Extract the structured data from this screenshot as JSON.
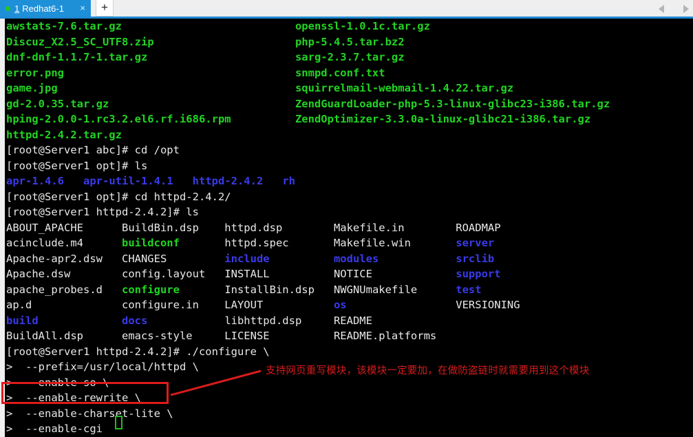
{
  "window": {
    "tab": {
      "index_label": "1",
      "title": "Redhat6-1",
      "status_dot": "connected-green-dot",
      "close_label": "×"
    },
    "new_tab_label": "+",
    "nav_prev_icon": "chevron-left-icon",
    "nav_next_icon": "chevron-right-icon"
  },
  "terminal": {
    "lines": [
      {
        "segments": [
          {
            "text": "awstats-7.6.tar.gz",
            "color": "green"
          },
          {
            "text": "                           ",
            "color": "white"
          },
          {
            "text": "openssl-1.0.1c.tar.gz",
            "color": "green"
          }
        ]
      },
      {
        "segments": [
          {
            "text": "Discuz_X2.5_SC_UTF8.zip",
            "color": "green"
          },
          {
            "text": "                      ",
            "color": "white"
          },
          {
            "text": "php-5.4.5.tar.bz2",
            "color": "green"
          }
        ]
      },
      {
        "segments": [
          {
            "text": "dnf-dnf-1.1.7-1.tar.gz",
            "color": "green"
          },
          {
            "text": "                       ",
            "color": "white"
          },
          {
            "text": "sarg-2.3.7.tar.gz",
            "color": "green"
          }
        ]
      },
      {
        "segments": [
          {
            "text": "error.png",
            "color": "green"
          },
          {
            "text": "                                    ",
            "color": "white"
          },
          {
            "text": "snmpd.conf.txt",
            "color": "green"
          }
        ]
      },
      {
        "segments": [
          {
            "text": "game.jpg",
            "color": "green"
          },
          {
            "text": "                                     ",
            "color": "white"
          },
          {
            "text": "squirrelmail-webmail-1.4.22.tar.gz",
            "color": "green"
          }
        ]
      },
      {
        "segments": [
          {
            "text": "gd-2.0.35.tar.gz",
            "color": "green"
          },
          {
            "text": "                             ",
            "color": "white"
          },
          {
            "text": "ZendGuardLoader-php-5.3-linux-glibc23-i386.tar.gz",
            "color": "green"
          }
        ]
      },
      {
        "segments": [
          {
            "text": "hping-2.0.0-1.rc3.2.el6.rf.i686.rpm",
            "color": "green"
          },
          {
            "text": "          ",
            "color": "white"
          },
          {
            "text": "ZendOptimizer-3.3.0a-linux-glibc21-i386.tar.gz",
            "color": "green"
          }
        ]
      },
      {
        "segments": [
          {
            "text": "httpd-2.4.2.tar.gz",
            "color": "green"
          }
        ]
      },
      {
        "segments": [
          {
            "text": "[root@Server1 abc]# cd /opt",
            "color": "white"
          }
        ]
      },
      {
        "segments": [
          {
            "text": "[root@Server1 opt]# ls",
            "color": "white"
          }
        ]
      },
      {
        "segments": [
          {
            "text": "apr-1.4.6",
            "color": "blue"
          },
          {
            "text": "   ",
            "color": "white"
          },
          {
            "text": "apr-util-1.4.1",
            "color": "blue"
          },
          {
            "text": "   ",
            "color": "white"
          },
          {
            "text": "httpd-2.4.2",
            "color": "blue"
          },
          {
            "text": "   ",
            "color": "white"
          },
          {
            "text": "rh",
            "color": "blue"
          }
        ]
      },
      {
        "segments": [
          {
            "text": "[root@Server1 opt]# cd httpd-2.4.2/",
            "color": "white"
          }
        ]
      },
      {
        "segments": [
          {
            "text": "[root@Server1 httpd-2.4.2]# ls",
            "color": "white"
          }
        ]
      },
      {
        "segments": [
          {
            "text": "ABOUT_APACHE      ",
            "color": "white"
          },
          {
            "text": "BuildBin.dsp    ",
            "color": "white"
          },
          {
            "text": "httpd.dsp        ",
            "color": "white"
          },
          {
            "text": "Makefile.in        ",
            "color": "white"
          },
          {
            "text": "ROADMAP",
            "color": "white"
          }
        ]
      },
      {
        "segments": [
          {
            "text": "acinclude.m4      ",
            "color": "white"
          },
          {
            "text": "buildconf",
            "color": "green"
          },
          {
            "text": "       ",
            "color": "white"
          },
          {
            "text": "httpd.spec       ",
            "color": "white"
          },
          {
            "text": "Makefile.win       ",
            "color": "white"
          },
          {
            "text": "server",
            "color": "blue"
          }
        ]
      },
      {
        "segments": [
          {
            "text": "Apache-apr2.dsw   ",
            "color": "white"
          },
          {
            "text": "CHANGES         ",
            "color": "white"
          },
          {
            "text": "include",
            "color": "blue"
          },
          {
            "text": "          ",
            "color": "white"
          },
          {
            "text": "modules",
            "color": "blue"
          },
          {
            "text": "            ",
            "color": "white"
          },
          {
            "text": "srclib",
            "color": "blue"
          }
        ]
      },
      {
        "segments": [
          {
            "text": "Apache.dsw        ",
            "color": "white"
          },
          {
            "text": "config.layout   ",
            "color": "white"
          },
          {
            "text": "INSTALL          ",
            "color": "white"
          },
          {
            "text": "NOTICE             ",
            "color": "white"
          },
          {
            "text": "support",
            "color": "blue"
          }
        ]
      },
      {
        "segments": [
          {
            "text": "apache_probes.d   ",
            "color": "white"
          },
          {
            "text": "configure",
            "color": "green"
          },
          {
            "text": "       ",
            "color": "white"
          },
          {
            "text": "InstallBin.dsp   ",
            "color": "white"
          },
          {
            "text": "NWGNUmakefile      ",
            "color": "white"
          },
          {
            "text": "test",
            "color": "blue"
          }
        ]
      },
      {
        "segments": [
          {
            "text": "ap.d              ",
            "color": "white"
          },
          {
            "text": "configure.in    ",
            "color": "white"
          },
          {
            "text": "LAYOUT           ",
            "color": "white"
          },
          {
            "text": "os",
            "color": "blue"
          },
          {
            "text": "                 ",
            "color": "white"
          },
          {
            "text": "VERSIONING",
            "color": "white"
          }
        ]
      },
      {
        "segments": [
          {
            "text": "build",
            "color": "blue"
          },
          {
            "text": "             ",
            "color": "white"
          },
          {
            "text": "docs",
            "color": "blue"
          },
          {
            "text": "            ",
            "color": "white"
          },
          {
            "text": "libhttpd.dsp     ",
            "color": "white"
          },
          {
            "text": "README",
            "color": "white"
          }
        ]
      },
      {
        "segments": [
          {
            "text": "BuildAll.dsp      ",
            "color": "white"
          },
          {
            "text": "emacs-style     ",
            "color": "white"
          },
          {
            "text": "LICENSE          ",
            "color": "white"
          },
          {
            "text": "README.platforms",
            "color": "white"
          }
        ]
      },
      {
        "segments": [
          {
            "text": "[root@Server1 httpd-2.4.2]# ./configure \\",
            "color": "white"
          }
        ]
      },
      {
        "segments": [
          {
            "text": ">  --prefix=/usr/local/httpd \\",
            "color": "white"
          }
        ]
      },
      {
        "segments": [
          {
            "text": ">  --enable-so \\",
            "color": "white"
          }
        ]
      },
      {
        "segments": [
          {
            "text": ">  --enable-rewrite \\",
            "color": "white"
          }
        ]
      },
      {
        "segments": [
          {
            "text": ">  --enable-charset-lite \\",
            "color": "white"
          }
        ]
      },
      {
        "segments": [
          {
            "text": ">  --enable-cgi",
            "color": "white"
          }
        ]
      }
    ]
  },
  "annotation": {
    "note_text": "支持网页重写模块，该模块一定要加，在做防盗链时就需要用到这个模块",
    "highlight_target": "--enable-rewrite \\",
    "color": "#d61c1c"
  },
  "colors": {
    "background": "#000000",
    "text_white": "#e8e8e8",
    "text_green": "#22d422",
    "text_blue": "#3a3ae8",
    "tab_active": "#1e90d8",
    "tab_underline": "#1f8ad2",
    "annotation_red": "#d61c1c",
    "cursor_green": "#1fbf1f"
  }
}
